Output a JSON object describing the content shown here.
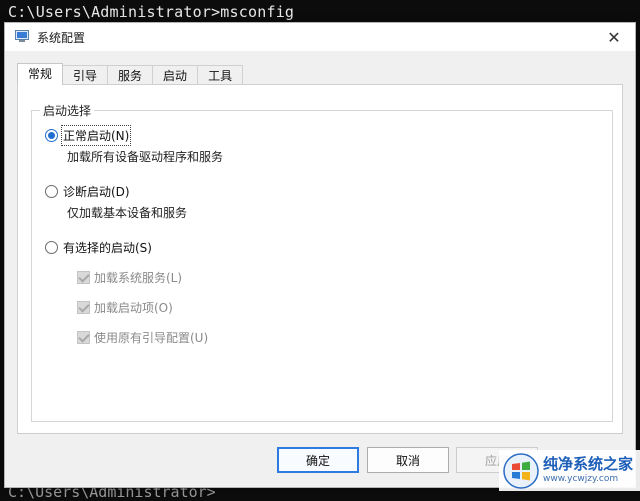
{
  "console": {
    "command_line": "C:\\Users\\Administrator>msconfig",
    "bottom_line": "C:\\Users\\Administrator>"
  },
  "window": {
    "title": "系统配置",
    "close_glyph": "✕"
  },
  "tabs": [
    {
      "label": "常规",
      "active": true
    },
    {
      "label": "引导",
      "active": false
    },
    {
      "label": "服务",
      "active": false
    },
    {
      "label": "启动",
      "active": false
    },
    {
      "label": "工具",
      "active": false
    }
  ],
  "startup_group": {
    "legend": "启动选择",
    "normal": {
      "label": "正常启动(N)",
      "description": "加载所有设备驱动程序和服务",
      "checked": true
    },
    "diagnostic": {
      "label": "诊断启动(D)",
      "description": "仅加载基本设备和服务",
      "checked": false
    },
    "selective": {
      "label": "有选择的启动(S)",
      "checked": false,
      "options": [
        {
          "label": "加载系统服务(L)",
          "checked": true,
          "enabled": false
        },
        {
          "label": "加载启动项(O)",
          "checked": true,
          "enabled": false
        },
        {
          "label": "使用原有引导配置(U)",
          "checked": true,
          "enabled": false
        }
      ]
    }
  },
  "buttons": {
    "ok": "确定",
    "cancel": "取消",
    "apply": "应用"
  },
  "watermark": {
    "name": "纯净系统之家",
    "url": "www.ycwjzy.com"
  },
  "colors": {
    "accent": "#1f6fd1",
    "default_button_border": "#2d7be0",
    "console_bg": "#0c0c0c"
  }
}
